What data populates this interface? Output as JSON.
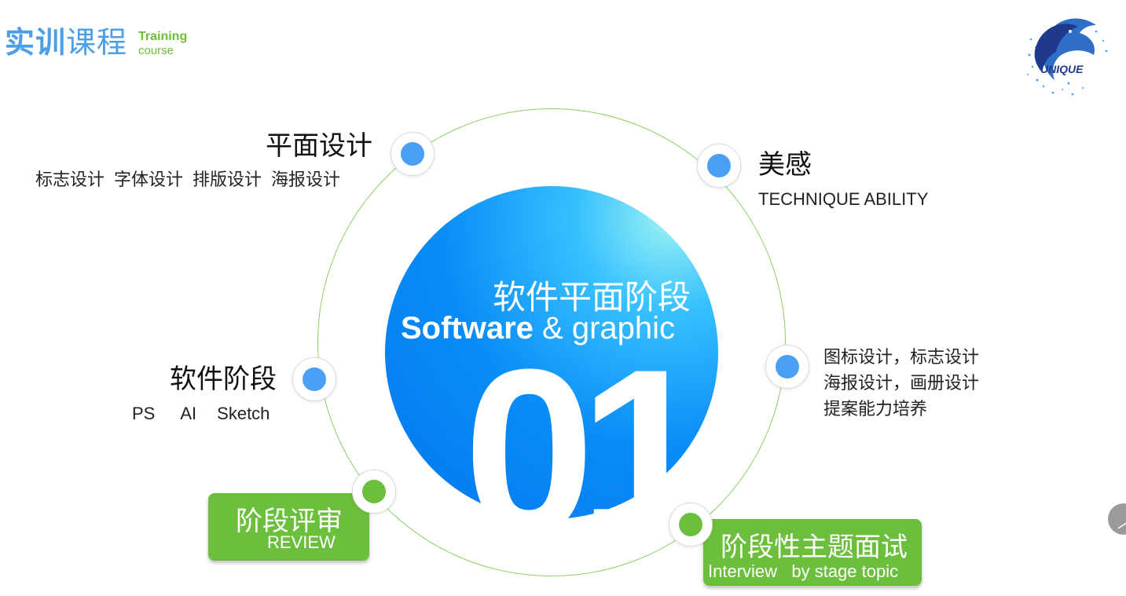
{
  "header": {
    "title_cn_a": "实训",
    "title_cn_b": "课程",
    "title_en_1": "Training",
    "title_en_2": "course"
  },
  "logo": {
    "text": "UNIQUE",
    "icon": "dolphin-logo-icon"
  },
  "center": {
    "cn": "软件平面阶段",
    "en_bold": "Software",
    "en_rest": " & graphic",
    "number": "01"
  },
  "nodes": {
    "graphic": {
      "title": "平面设计",
      "items": [
        "标志设计",
        "字体设计",
        "排版设计",
        "海报设计"
      ]
    },
    "aesthetic": {
      "title": "美感",
      "subtitle": "TECHNIQUE ABILITY"
    },
    "software": {
      "title": "软件阶段",
      "items": [
        "PS",
        "AI",
        "Sketch"
      ]
    },
    "design_skills": {
      "lines": [
        "图标设计，标志设计",
        "海报设计，画册设计",
        "提案能力培养"
      ]
    },
    "review": {
      "cn": "阶段评审",
      "en": "REVIEW"
    },
    "interview": {
      "cn": "阶段性主题面试",
      "en": "Interview   by stage topic"
    }
  },
  "colors": {
    "blue": "#4a9ff2",
    "green": "#6cbf3c",
    "title_blue": "#4a9fe8"
  },
  "scroll_button": {
    "icon": "chevron-up-icon"
  }
}
